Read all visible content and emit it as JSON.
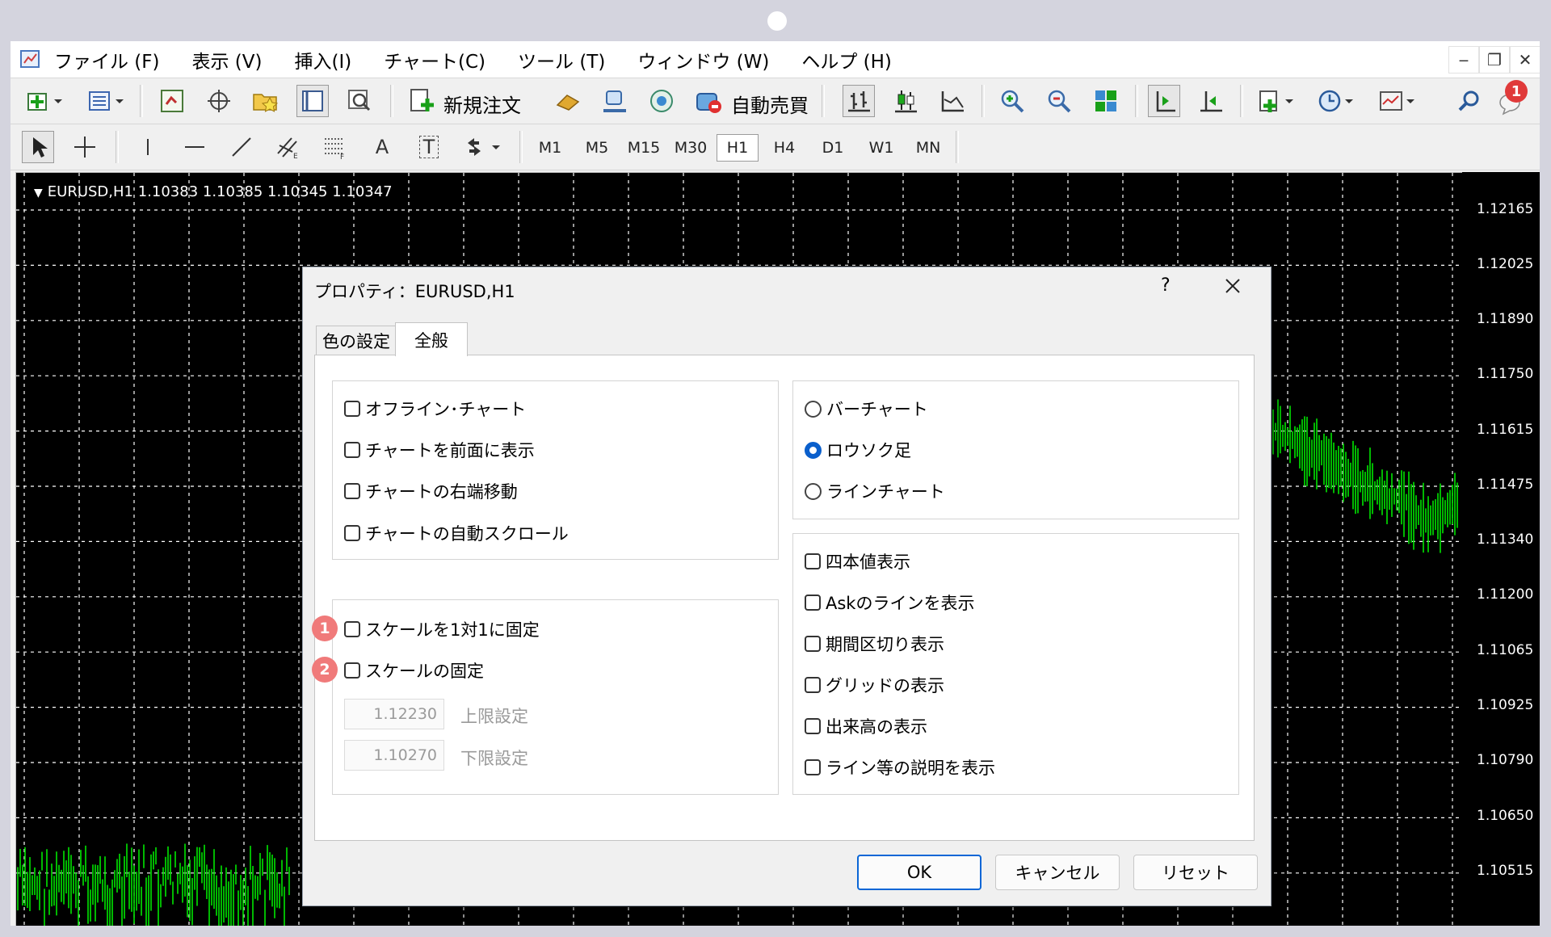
{
  "menubar": {
    "items": [
      "ファイル (F)",
      "表示 (V)",
      "挿入(I)",
      "チャート(C)",
      "ツール (T)",
      "ウィンドウ (W)",
      "ヘルプ (H)"
    ],
    "controls": [
      "‒",
      "❐",
      "✕"
    ]
  },
  "toolbar": {
    "new_order": "新規注文",
    "auto_trade": "自動売買",
    "notification_count": "1"
  },
  "timeframes": {
    "items": [
      "M1",
      "M5",
      "M15",
      "M30",
      "H1",
      "H4",
      "D1",
      "W1",
      "MN"
    ],
    "selected": "H1"
  },
  "line_tools": {
    "text": "A",
    "text_label": "T"
  },
  "chart": {
    "info": "EURUSD,H1  1.10383 1.10385 1.10345 1.10347",
    "price_labels": [
      "1.12165",
      "1.12025",
      "1.11890",
      "1.11750",
      "1.11615",
      "1.11475",
      "1.11340",
      "1.11200",
      "1.11065",
      "1.10925",
      "1.10790",
      "1.10650",
      "1.10515"
    ],
    "candle_color": "#00e600",
    "grid_color": "#ffffff"
  },
  "dialog": {
    "title": "プロパティ：EURUSD,H1",
    "help": "?",
    "tabs": [
      "色の設定",
      "全般"
    ],
    "active_tab": "全般",
    "left_top": [
      {
        "label": "オフライン･チャート",
        "checked": false
      },
      {
        "label": "チャートを前面に表示",
        "checked": false
      },
      {
        "label": "チャートの右端移動",
        "checked": false
      },
      {
        "label": "チャートの自動スクロール",
        "checked": false
      }
    ],
    "scale": {
      "fix_1to1": "スケールを1対1に固定",
      "fix_scale": "スケールの固定",
      "badge1": "1",
      "badge2": "2",
      "upper_value": "1.12230",
      "upper_label": "上限設定",
      "lower_value": "1.10270",
      "lower_label": "下限設定"
    },
    "chart_type": [
      {
        "label": "バーチャート",
        "selected": false
      },
      {
        "label": "ロウソク足",
        "selected": true
      },
      {
        "label": "ラインチャート",
        "selected": false
      }
    ],
    "display_options": [
      {
        "label": "四本値表示",
        "checked": false
      },
      {
        "label": "Askのラインを表示",
        "checked": false
      },
      {
        "label": "期間区切り表示",
        "checked": false
      },
      {
        "label": "グリッドの表示",
        "checked": false
      },
      {
        "label": "出来高の表示",
        "checked": false
      },
      {
        "label": "ライン等の説明を表示",
        "checked": false
      }
    ],
    "buttons": {
      "ok": "OK",
      "cancel": "キャンセル",
      "reset": "リセット"
    }
  }
}
